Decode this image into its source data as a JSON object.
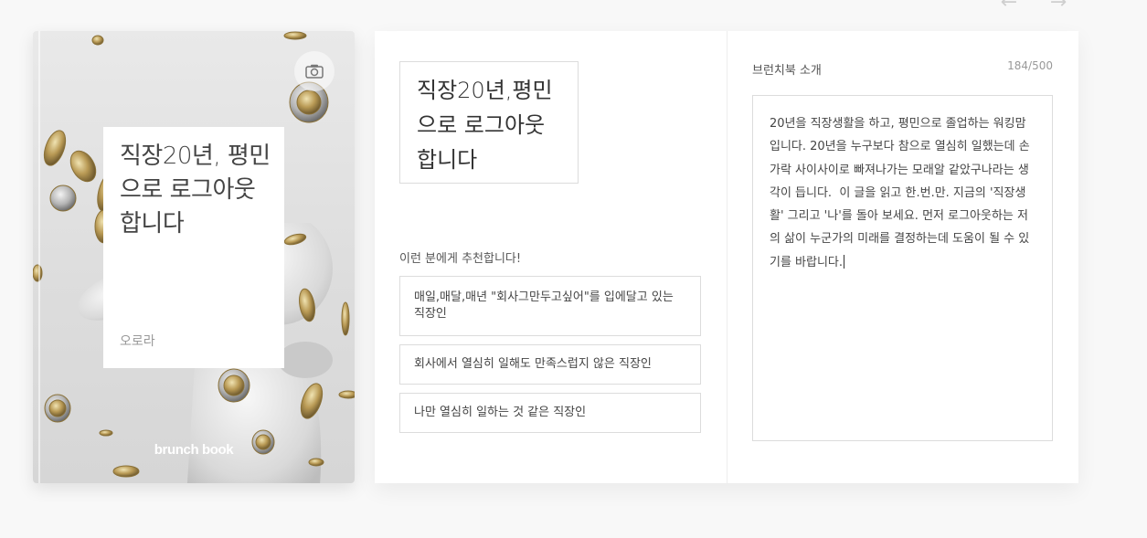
{
  "nav": {
    "prev_icon": "arrow-left-icon",
    "next_icon": "arrow-right-icon"
  },
  "cover": {
    "title": "직장20년, 평민으로 로그아웃합니다",
    "author": "오로라",
    "brand": "brunch book",
    "camera_icon": "camera-icon"
  },
  "book": {
    "title": "직장20년,평민으로 로그아웃합니다"
  },
  "recommend": {
    "heading": "이런 분에게 추천합니다!",
    "items": [
      "매일,매달,매년 \"회사그만두고싶어\"를 입에달고 있는 직장인",
      "회사에서 열심히 일해도 만족스럽지 않은 직장인",
      "나만 열심히 일하는 것 같은 직장인"
    ]
  },
  "intro": {
    "label": "브런치북 소개",
    "count": "184/500",
    "text": "20년을 직장생활을 하고, 평민으로 졸업하는 워킹맘입니다. 20년을 누구보다 참으로 열심히 일했는데 손가락 사이사이로 빠져나가는 모래알 같았구나라는 생각이 듭니다.  이 글을 읽고 한.번.만. 지금의 '직장생활' 그리고 '나'를 돌아 보세요. 먼저 로그아웃하는 저의 삶이 누군가의 미래를 결정하는데 도움이 될 수 있기를 바랍니다."
  }
}
